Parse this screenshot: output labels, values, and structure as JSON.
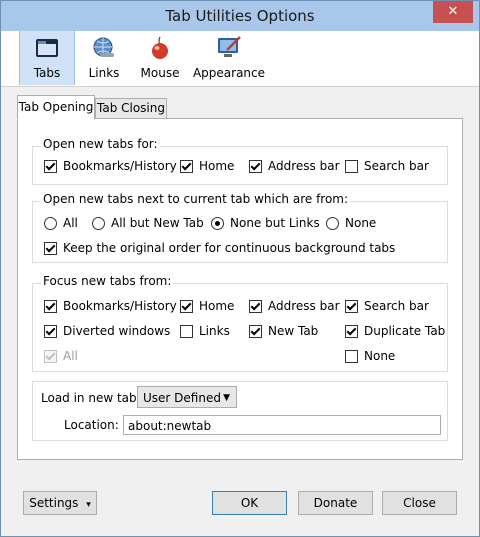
{
  "window": {
    "title": "Tab Utilities Options",
    "close": "✕"
  },
  "toolbar": {
    "items": [
      {
        "label": "Tabs"
      },
      {
        "label": "Links"
      },
      {
        "label": "Mouse"
      },
      {
        "label": "Appearance"
      }
    ]
  },
  "tabs": {
    "opening": "Tab Opening",
    "closing": "Tab Closing"
  },
  "open_new_tabs_for": {
    "label": "Open new tabs for:",
    "options": [
      {
        "label": "Bookmarks/History",
        "checked": true
      },
      {
        "label": "Home",
        "checked": true
      },
      {
        "label": "Address bar",
        "checked": true
      },
      {
        "label": "Search bar",
        "checked": false
      }
    ]
  },
  "open_next_to": {
    "label": "Open new tabs next to current tab which are from:",
    "radios": [
      {
        "label": "All",
        "checked": false
      },
      {
        "label": "All but New Tab",
        "checked": false
      },
      {
        "label": "None but Links",
        "checked": true
      },
      {
        "label": "None",
        "checked": false
      }
    ],
    "keep_order": {
      "label": "Keep the original order for continuous background tabs",
      "checked": true
    }
  },
  "focus_new_tabs": {
    "label": "Focus new tabs from:",
    "options": [
      {
        "label": "Bookmarks/History",
        "checked": true
      },
      {
        "label": "Home",
        "checked": true
      },
      {
        "label": "Address bar",
        "checked": true
      },
      {
        "label": "Search bar",
        "checked": true
      },
      {
        "label": "Diverted windows",
        "checked": true
      },
      {
        "label": "Links",
        "checked": false
      },
      {
        "label": "New Tab",
        "checked": true
      },
      {
        "label": "Duplicate Tab",
        "checked": true
      },
      {
        "label": "All",
        "checked": true,
        "disabled": true
      },
      {
        "label": "None",
        "checked": false
      }
    ]
  },
  "load_in_new_tab": {
    "label": "Load in new tab:",
    "value": "User Defined",
    "location_label": "Location:",
    "location_value": "about:newtab"
  },
  "buttons": {
    "settings": "Settings",
    "settings_arrow": "▾",
    "ok": "OK",
    "donate": "Donate",
    "close": "Close"
  },
  "colors": {
    "accent": "#cfe2f6",
    "titlebar": "#a9c7ea",
    "close": "#c75050"
  }
}
